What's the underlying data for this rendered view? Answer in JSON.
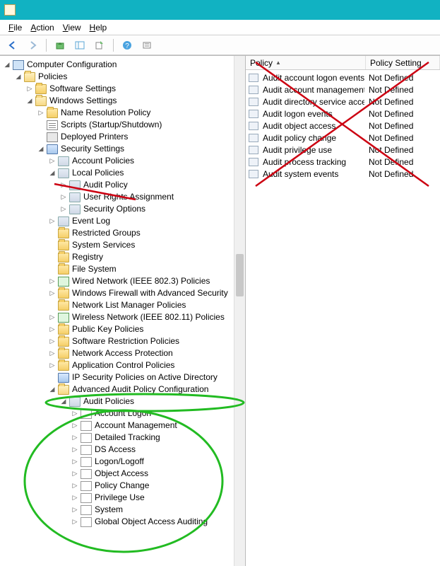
{
  "menus": {
    "file": "File",
    "action": "Action",
    "view": "View",
    "help": "Help"
  },
  "tree": {
    "root": "Computer Configuration",
    "policies": "Policies",
    "software_settings": "Software Settings",
    "windows_settings": "Windows Settings",
    "name_res": "Name Resolution Policy",
    "scripts": "Scripts (Startup/Shutdown)",
    "printers": "Deployed Printers",
    "security": "Security Settings",
    "account_policies": "Account Policies",
    "local_policies": "Local Policies",
    "audit_policy": "Audit Policy",
    "user_rights": "User Rights Assignment",
    "security_options": "Security Options",
    "event_log": "Event Log",
    "restricted_groups": "Restricted Groups",
    "system_services": "System Services",
    "registry": "Registry",
    "file_system": "File System",
    "wired": "Wired Network (IEEE 802.3) Policies",
    "firewall": "Windows Firewall with Advanced Security",
    "netlist": "Network List Manager Policies",
    "wireless": "Wireless Network (IEEE 802.11) Policies",
    "pubkey": "Public Key Policies",
    "srp": "Software Restriction Policies",
    "nap": "Network Access Protection",
    "appcontrol": "Application Control Policies",
    "ipsec": "IP Security Policies on Active Directory",
    "aapc": "Advanced Audit Policy Configuration",
    "audit_policies": "Audit Policies",
    "ap_account_logon": "Account Logon",
    "ap_account_mgmt": "Account Management",
    "ap_detailed": "Detailed Tracking",
    "ap_ds": "DS Access",
    "ap_logon": "Logon/Logoff",
    "ap_object": "Object Access",
    "ap_policy": "Policy Change",
    "ap_priv": "Privilege Use",
    "ap_system": "System",
    "ap_global": "Global Object Access Auditing"
  },
  "list": {
    "col_policy": "Policy",
    "col_setting": "Policy Setting",
    "rows": [
      {
        "name": "Audit account logon events",
        "setting": "Not Defined"
      },
      {
        "name": "Audit account management",
        "setting": "Not Defined"
      },
      {
        "name": "Audit directory service access",
        "setting": "Not Defined"
      },
      {
        "name": "Audit logon events",
        "setting": "Not Defined"
      },
      {
        "name": "Audit object access",
        "setting": "Not Defined"
      },
      {
        "name": "Audit policy change",
        "setting": "Not Defined"
      },
      {
        "name": "Audit privilege use",
        "setting": "Not Defined"
      },
      {
        "name": "Audit process tracking",
        "setting": "Not Defined"
      },
      {
        "name": "Audit system events",
        "setting": "Not Defined"
      }
    ]
  }
}
